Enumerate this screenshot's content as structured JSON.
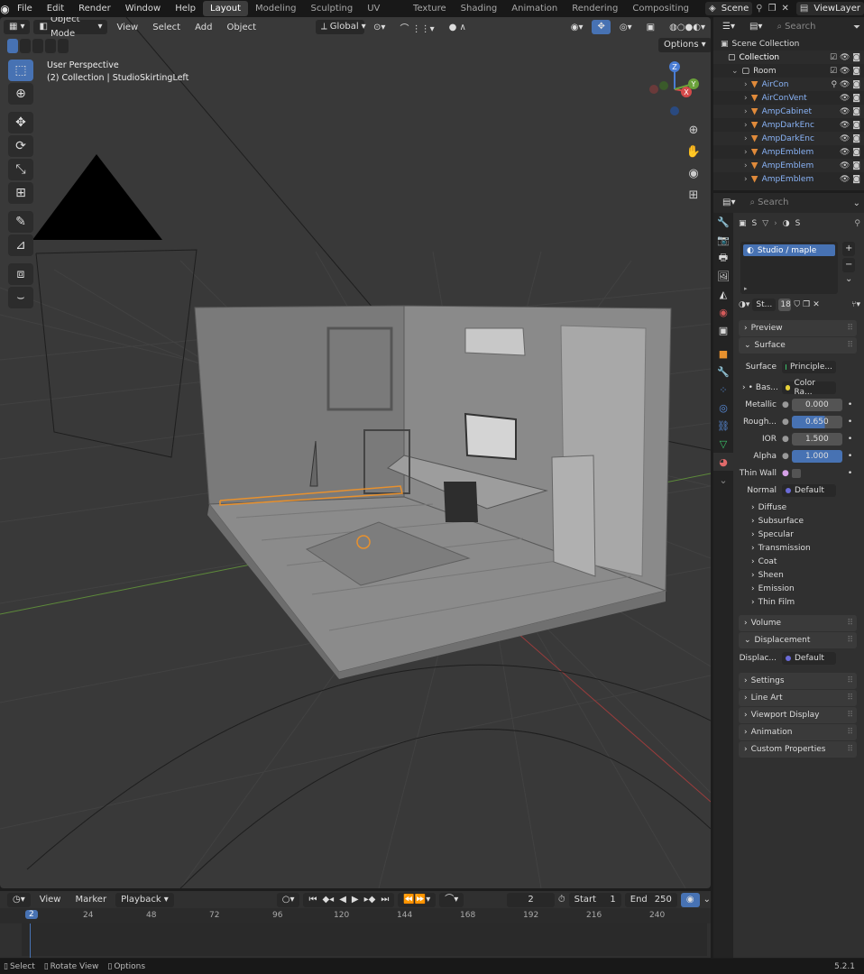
{
  "topbar": {
    "menus": [
      "File",
      "Edit",
      "Render",
      "Window",
      "Help"
    ],
    "workspaces": [
      "Layout",
      "Modeling",
      "Sculpting",
      "UV Editing",
      "Texture Paint",
      "Shading",
      "Animation",
      "Rendering",
      "Compositing"
    ],
    "active_workspace": "Layout",
    "scene": "Scene",
    "view_layer": "ViewLayer"
  },
  "viewport": {
    "mode": "Object Mode",
    "menus": [
      "View",
      "Select",
      "Add",
      "Object"
    ],
    "orientation": "Global",
    "options_label": "Options",
    "info_line1": "User Perspective",
    "info_line2": "(2) Collection | StudioSkirtingLeft",
    "gizmo": {
      "x": "X",
      "y": "Y",
      "z": "Z"
    }
  },
  "outliner": {
    "search_placeholder": "Search",
    "rows": [
      {
        "label": "Scene Collection"
      },
      {
        "label": "Collection"
      },
      {
        "label": "Room"
      },
      {
        "label": "AirCon"
      },
      {
        "label": "AirConVent"
      },
      {
        "label": "AmpCabinet"
      },
      {
        "label": "AmpDarkEnc"
      },
      {
        "label": "AmpDarkEnc"
      },
      {
        "label": "AmpEmblem"
      },
      {
        "label": "AmpEmblem"
      },
      {
        "label": "AmpEmblem"
      }
    ]
  },
  "properties": {
    "search_placeholder": "Search",
    "breadcrumb_a": "S",
    "breadcrumb_b": "S",
    "material_slot": "Studio / maple",
    "material_short": "St...",
    "user_count": "18",
    "panels": {
      "preview": "Preview",
      "surface": "Surface",
      "volume": "Volume",
      "displacement": "Displacement",
      "settings": "Settings",
      "line_art": "Line Art",
      "viewport_display": "Viewport Display",
      "animation": "Animation",
      "custom_properties": "Custom Properties"
    },
    "surface_label": "Surface",
    "surface_value": "Principle...",
    "base_label": "Bas...",
    "base_value": "Color Ra...",
    "metallic_label": "Metallic",
    "metallic_value": "0.000",
    "roughness_label": "Rough...",
    "roughness_value": "0.650",
    "ior_label": "IOR",
    "ior_value": "1.500",
    "alpha_label": "Alpha",
    "alpha_value": "1.000",
    "thinwall_label": "Thin Wall",
    "normal_label": "Normal",
    "normal_value": "Default",
    "subpanels": [
      "Diffuse",
      "Subsurface",
      "Specular",
      "Transmission",
      "Coat",
      "Sheen",
      "Emission",
      "Thin Film"
    ],
    "displacement_label": "Displac...",
    "displacement_value": "Default"
  },
  "timeline": {
    "menus": [
      "View",
      "Marker"
    ],
    "playback": "Playback",
    "current_frame": "2",
    "start_label": "Start",
    "start_value": "1",
    "end_label": "End",
    "end_value": "250",
    "ticks": [
      "2",
      "24",
      "48",
      "72",
      "96",
      "120",
      "144",
      "168",
      "192",
      "216",
      "240"
    ]
  },
  "statusbar": {
    "select": "Select",
    "rotate": "Rotate View",
    "options": "Options",
    "version": "5.2.1"
  },
  "colors": {
    "accent": "#4772b3",
    "selection_orange": "#e8912e",
    "viewport_bg": "#393939"
  }
}
